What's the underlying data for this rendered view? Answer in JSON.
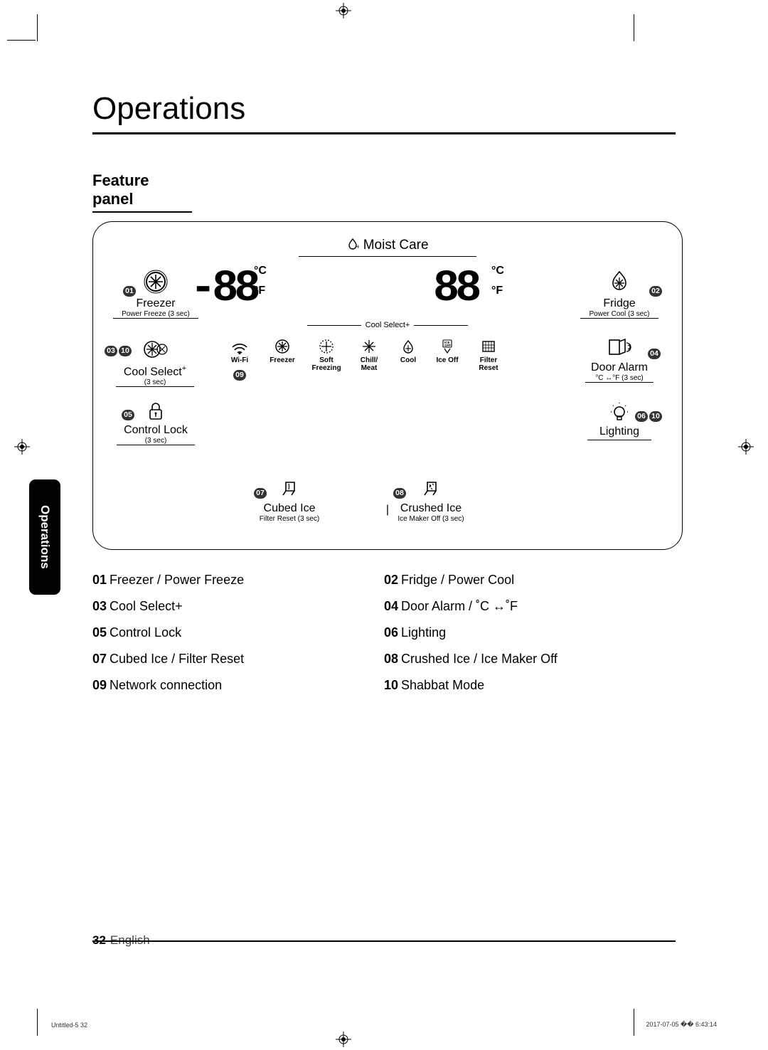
{
  "title": "Operations",
  "subtitle": "Feature panel",
  "side_tab": "Operations",
  "footer": {
    "page": "32",
    "lang": "English",
    "doc": "Untitled-5   32",
    "ts": "2017-07-05   �� 6:43:14"
  },
  "moist_care": "Moist Care",
  "cool_select_line": "Cool Select+",
  "freezer": {
    "badge": "01",
    "label": "Freezer",
    "sub": "Power Freeze (3 sec)",
    "display": "-88",
    "unit_c": "°C",
    "unit_f": "°F"
  },
  "fridge": {
    "badge": "02",
    "label": "Fridge",
    "sub": "Power Cool (3 sec)",
    "display": "88",
    "unit_c": "°C",
    "unit_f": "°F"
  },
  "coolselect": {
    "badge1": "03",
    "badge2": "10",
    "label": "Cool Select",
    "plus": "+",
    "sub": "(3 sec)"
  },
  "coolselect_items": {
    "wifi": "Wi-Fi",
    "freezer": "Freezer",
    "soft1": "Soft",
    "soft2": "Freezing",
    "chill1": "Chill/",
    "chill2": "Meat",
    "cool": "Cool",
    "iceoff": "Ice Off",
    "filter1": "Filter",
    "filter2": "Reset",
    "badge09": "09"
  },
  "dooralarm": {
    "badge": "04",
    "label": "Door Alarm",
    "sub": "°C ↔°F (3 sec)"
  },
  "controllock": {
    "badge": "05",
    "label": "Control Lock",
    "sub": "(3 sec)"
  },
  "lighting": {
    "badge1": "06",
    "badge2": "10",
    "label": "Lighting"
  },
  "cubedice": {
    "badge": "07",
    "label": "Cubed Ice",
    "sub": "Filter Reset (3 sec)"
  },
  "crushedice": {
    "badge": "08",
    "label": "Crushed Ice",
    "sub": "Ice Maker Off (3 sec)"
  },
  "divider": "|",
  "legend": [
    {
      "n": "01",
      "t": "Freezer / Power Freeze"
    },
    {
      "n": "02",
      "t": "Fridge / Power Cool"
    },
    {
      "n": "03",
      "t": "Cool Select+"
    },
    {
      "n": "04",
      "t": "Door Alarm / ˚C ↔˚F"
    },
    {
      "n": "05",
      "t": "Control Lock"
    },
    {
      "n": "06",
      "t": "Lighting"
    },
    {
      "n": "07",
      "t": "Cubed Ice / Filter Reset"
    },
    {
      "n": "08",
      "t": "Crushed Ice / Ice Maker Off"
    },
    {
      "n": "09",
      "t": "Network connection"
    },
    {
      "n": "10",
      "t": "Shabbat Mode"
    }
  ]
}
